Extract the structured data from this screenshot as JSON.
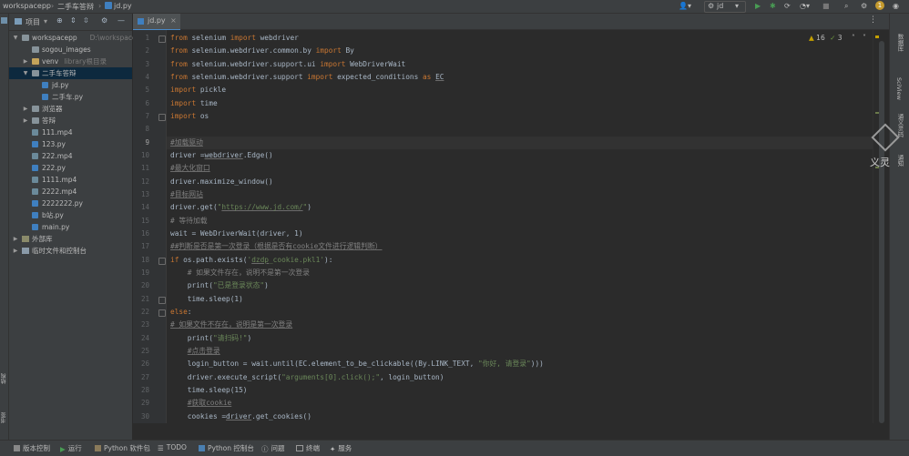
{
  "titlebar": {
    "project": "workspacepp",
    "breadcrumb_folder": "二手车答辩",
    "breadcrumb_file": "jd.py",
    "run_config": "jd",
    "notification_count": "1"
  },
  "left_strip": {
    "project_label": "项目",
    "bottom_labels": [
      "结构",
      "书签"
    ]
  },
  "project_panel": {
    "title": "项目",
    "tree": [
      {
        "label": "workspacepp",
        "note": "D:\\workspacepp",
        "type": "folder",
        "depth": 0,
        "expanded": true
      },
      {
        "label": "sogou_images",
        "type": "folder",
        "depth": 1,
        "expanded": null
      },
      {
        "label": "venv",
        "note": "library根目录",
        "type": "folder-yellow",
        "depth": 1,
        "expanded": false
      },
      {
        "label": "二手车答辩",
        "type": "folder",
        "depth": 1,
        "expanded": true,
        "selected": true
      },
      {
        "label": "jd.py",
        "type": "py",
        "depth": 2
      },
      {
        "label": "二手车.py",
        "type": "py",
        "depth": 2
      },
      {
        "label": "浏览器",
        "type": "folder",
        "depth": 1,
        "expanded": false
      },
      {
        "label": "答辩",
        "type": "folder",
        "depth": 1,
        "expanded": false
      },
      {
        "label": "111.mp4",
        "type": "mp4",
        "depth": 1
      },
      {
        "label": "123.py",
        "type": "py",
        "depth": 1
      },
      {
        "label": "222.mp4",
        "type": "mp4",
        "depth": 1
      },
      {
        "label": "222.py",
        "type": "py",
        "depth": 1
      },
      {
        "label": "1111.mp4",
        "type": "mp4",
        "depth": 1
      },
      {
        "label": "2222.mp4",
        "type": "mp4",
        "depth": 1
      },
      {
        "label": "2222222.py",
        "type": "py",
        "depth": 1
      },
      {
        "label": "b站.py",
        "type": "py",
        "depth": 1
      },
      {
        "label": "main.py",
        "type": "py",
        "depth": 1
      },
      {
        "label": "外部库",
        "type": "lib",
        "depth": 0,
        "expanded": false
      },
      {
        "label": "临时文件和控制台",
        "type": "scratch",
        "depth": 0,
        "expanded": false
      }
    ]
  },
  "editor": {
    "tab_label": "jd.py",
    "warnings": "16",
    "weak_warnings": "3",
    "lines": [
      {
        "n": "1",
        "html": "<span class='kw'>from</span> selenium <span class='kw'>import</span> webdriver"
      },
      {
        "n": "2",
        "html": "<span class='kw'>from</span> selenium.webdriver.common.by <span class='kw'>import</span> By"
      },
      {
        "n": "3",
        "html": "<span class='kw'>from</span> selenium.webdriver.support.ui <span class='kw'>import</span> WebDriverWait"
      },
      {
        "n": "4",
        "html": "<span class='kw'>from</span> selenium.webdriver.support <span class='kw'>import</span> expected_conditions <span class='kw'>as</span> <span class='und'>EC</span>"
      },
      {
        "n": "5",
        "html": "<span class='kw'>import</span> pickle"
      },
      {
        "n": "6",
        "html": "<span class='kw'>import</span> time"
      },
      {
        "n": "7",
        "html": "<span class='kw'>import</span> os"
      },
      {
        "n": "8",
        "html": ""
      },
      {
        "n": "9",
        "html": "<span class='cmt und'>#加载驱动</span>",
        "hl": true
      },
      {
        "n": "10",
        "html": "driver =<span class='und'>webdriver</span>.Edge()"
      },
      {
        "n": "11",
        "html": "<span class='cmt und'>#最大化窗口</span>"
      },
      {
        "n": "12",
        "html": "driver.maximize_window()"
      },
      {
        "n": "13",
        "html": "<span class='cmt und'>#目标网站</span>"
      },
      {
        "n": "14",
        "html": "driver.get(<span class='str'>\"<span class='und'>https://www.jd.com/</span>\"</span>)"
      },
      {
        "n": "15",
        "html": "<span class='cmt'># 等待加载</span>"
      },
      {
        "n": "16",
        "html": "wait = WebDriverWait(driver, 1)"
      },
      {
        "n": "17",
        "html": "<span class='cmt und'>##判断是否是第一次登录（根据是否有cookie文件进行逻辑判断）</span>"
      },
      {
        "n": "18",
        "html": "<span class='kw'>if</span> os.path.exists(<span class='str'>'<span class='und'>dzdp</span>_cookie.pkl1'</span>):"
      },
      {
        "n": "19",
        "html": "    <span class='cmt'># 如果文件存在，说明不是第一次登录</span>"
      },
      {
        "n": "20",
        "html": "    print(<span class='str'>\"已是登录状态\"</span>)"
      },
      {
        "n": "21",
        "html": "    time.sleep(1)"
      },
      {
        "n": "22",
        "html": "<span class='kw'>else</span>:"
      },
      {
        "n": "23",
        "html": "<span class='cmt und'># 如果文件不存在，说明是第一次登录</span>"
      },
      {
        "n": "24",
        "html": "    print(<span class='str'>\"请扫码!\"</span>)"
      },
      {
        "n": "25",
        "html": "    <span class='cmt und'>#点击登录</span>"
      },
      {
        "n": "26",
        "html": "    login_button = wait.until(EC.element_to_be_clickable((By.LINK_TEXT, <span class='str'>\"你好, 请登录\"</span>)))"
      },
      {
        "n": "27",
        "html": "    driver.execute_script(<span class='str'>\"arguments[0].click();\"</span>, login_button)"
      },
      {
        "n": "28",
        "html": "    time.sleep(15)"
      },
      {
        "n": "29",
        "html": "    <span class='cmt und'>#获取cookie</span>"
      },
      {
        "n": "30",
        "html": "    cookies =<span class='und'>driver</span>.get_cookies()"
      }
    ]
  },
  "right_strip": {
    "labels": [
      "数据库",
      "SciView",
      "通义灵码",
      "通知"
    ]
  },
  "watermark": {
    "text": "义灵"
  },
  "bottombar": {
    "items": [
      "版本控制",
      "运行",
      "Python 软件包",
      "TODO",
      "Python 控制台",
      "问题",
      "终端",
      "服务"
    ]
  },
  "colors": {
    "background": "#2b2b2b",
    "panel": "#3c3f41",
    "keyword": "#cc7832",
    "string": "#6a8759",
    "comment": "#808080",
    "selection": "#0d293e",
    "run_green": "#499c54"
  }
}
